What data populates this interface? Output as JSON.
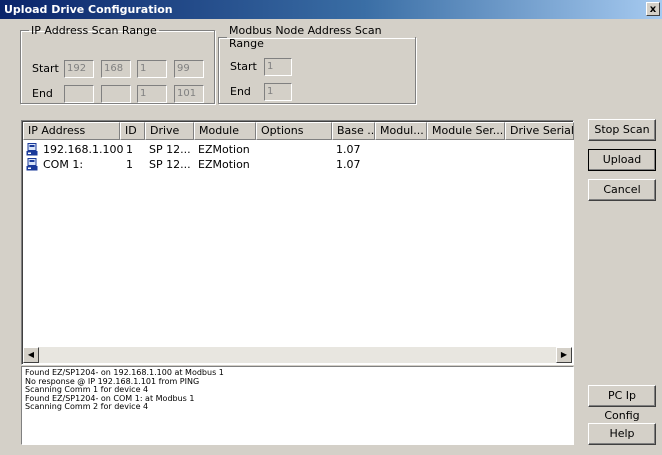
{
  "window": {
    "title": "Upload Drive Configuration",
    "close_glyph": "x"
  },
  "ip_range": {
    "title": "IP Address Scan Range",
    "start_label": "Start",
    "end_label": "End",
    "start": [
      "192",
      "168",
      "1",
      "99"
    ],
    "end": [
      "",
      "",
      "1",
      "101"
    ]
  },
  "modbus_range": {
    "title": "Modbus Node Address Scan Range",
    "start_label": "Start",
    "end_label": "End",
    "start": "1",
    "end": "1"
  },
  "table": {
    "columns": [
      "IP Address",
      "ID",
      "Drive",
      "Module",
      "Options",
      "Base ...",
      "Modul...",
      "Module Ser...",
      "Drive Serial"
    ],
    "rows": [
      {
        "icon": "drive-icon",
        "cells": [
          "192.168.1.100",
          "1",
          "SP 12...",
          "EZMotion",
          "",
          "1.07",
          "",
          "",
          ""
        ]
      },
      {
        "icon": "drive-icon",
        "cells": [
          "COM 1:",
          "1",
          "SP 12...",
          "EZMotion",
          "",
          "1.07",
          "",
          "",
          ""
        ]
      }
    ]
  },
  "log": {
    "lines": [
      "Found EZ/SP1204- on 192.168.1.100 at Modbus 1",
      "No response @ IP 192.168.1.101 from PING",
      "Scanning Comm 1 for device 4",
      "Found EZ/SP1204- on COM 1: at Modbus 1",
      "Scanning Comm 2 for device 4"
    ]
  },
  "buttons": {
    "stop_scan": "Stop Scan",
    "upload": "Upload",
    "cancel": "Cancel",
    "pc_ip_config": "PC Ip Config",
    "help": "Help"
  },
  "colors": {
    "title_bar": "#0a246a",
    "dialog_bg": "#d4d0c8",
    "list_bg": "#ffffff"
  }
}
